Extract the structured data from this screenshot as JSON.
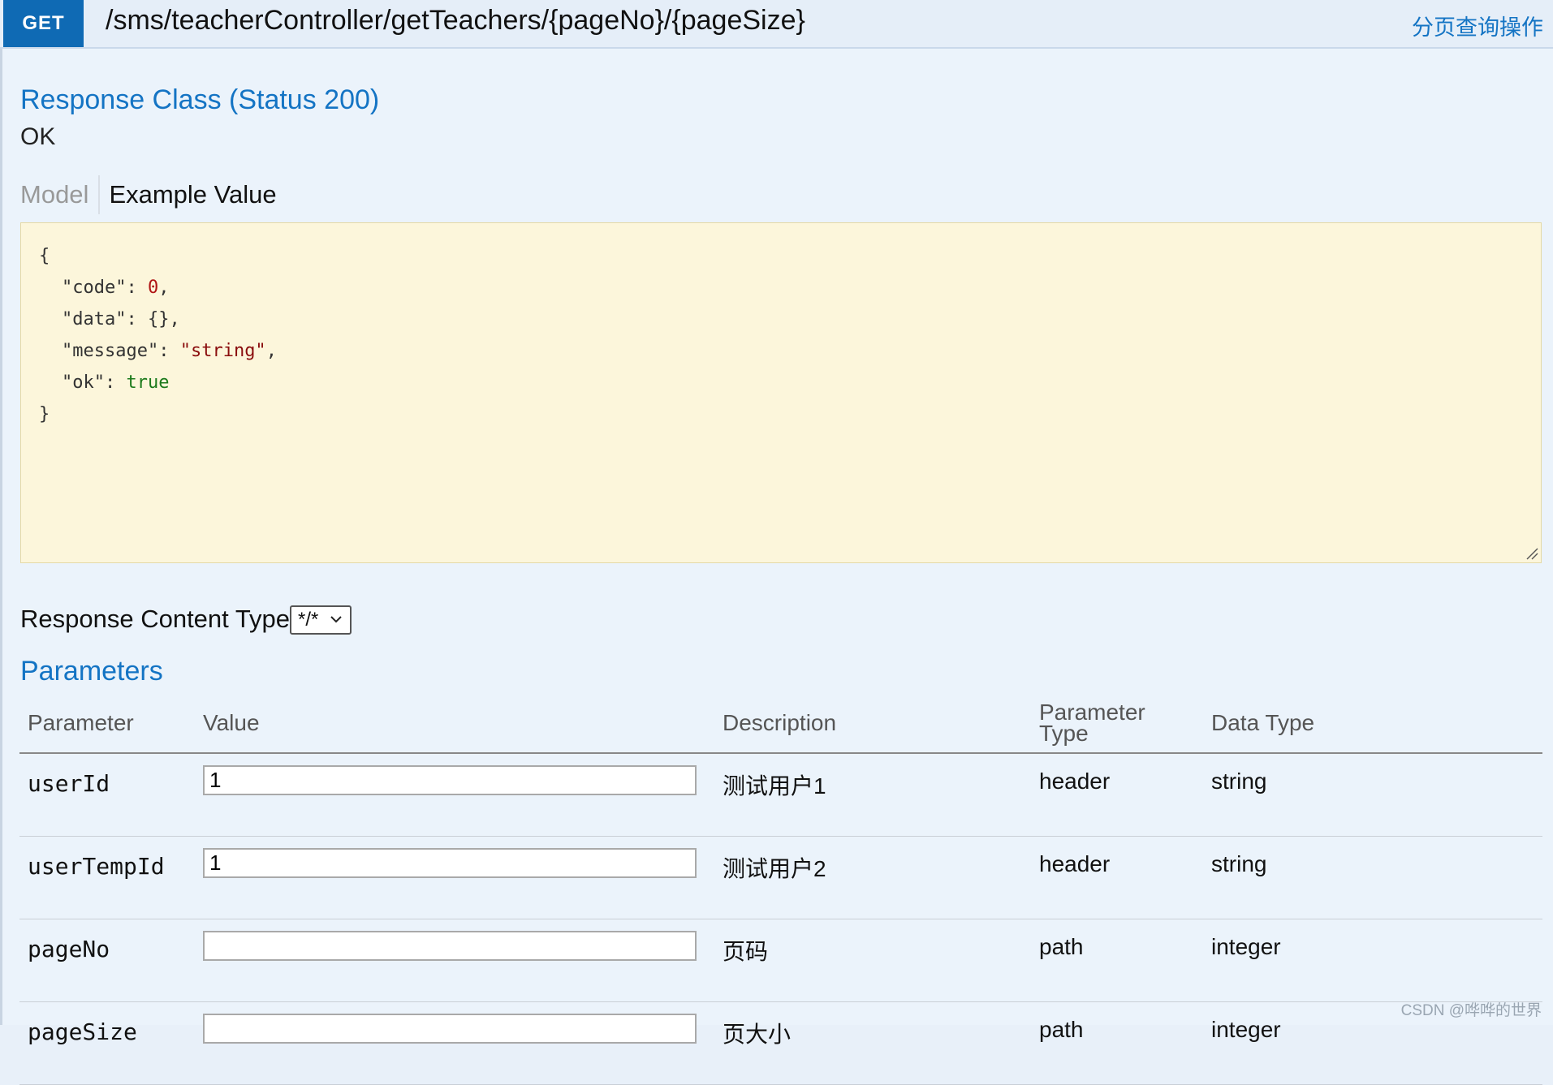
{
  "operation": {
    "method": "GET",
    "path": "/sms/teacherController/getTeachers/{pageNo}/{pageSize}",
    "summary": "分页查询操作"
  },
  "response": {
    "heading": "Response Class (Status 200)",
    "status_text": "OK",
    "tabs": [
      {
        "label": "Model",
        "active": false
      },
      {
        "label": "Example Value",
        "active": true
      }
    ],
    "example": {
      "open": "{",
      "lines": [
        {
          "key": "\"code\"",
          "value": "0",
          "type": "number"
        },
        {
          "key": "\"data\"",
          "value": "{}",
          "type": "plain"
        },
        {
          "key": "\"message\"",
          "value": "\"string\"",
          "type": "string"
        },
        {
          "key": "\"ok\"",
          "value": "true",
          "type": "boolean"
        }
      ],
      "close": "}"
    }
  },
  "content_type": {
    "label": "Response Content Type",
    "selected": "*/*"
  },
  "parameters": {
    "heading": "Parameters",
    "columns": [
      "Parameter",
      "Value",
      "Description",
      "Parameter\nType",
      "Data Type"
    ],
    "column_labels": {
      "parameter": "Parameter",
      "value": "Value",
      "description": "Description",
      "ptype_line1": "Parameter",
      "ptype_line2": "Type",
      "data_type": "Data Type"
    },
    "rows": [
      {
        "name": "userId",
        "value": "1",
        "description": "测试用户1",
        "param_type": "header",
        "data_type": "string"
      },
      {
        "name": "userTempId",
        "value": "1",
        "description": "测试用户2",
        "param_type": "header",
        "data_type": "string"
      },
      {
        "name": "pageNo",
        "value": "",
        "description": "页码",
        "param_type": "path",
        "data_type": "integer"
      },
      {
        "name": "pageSize",
        "value": "",
        "description": "页大小",
        "param_type": "path",
        "data_type": "integer"
      }
    ]
  },
  "watermark": "CSDN @哗哗的世界",
  "colors": {
    "method_badge": "#0f6ab4",
    "link_blue": "#1474c4",
    "example_bg": "#fcf6db",
    "page_bg": "#ebf3fb"
  }
}
